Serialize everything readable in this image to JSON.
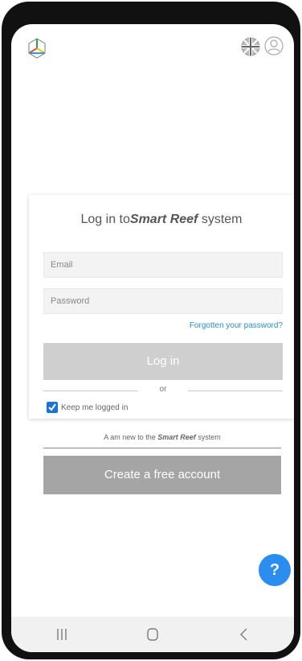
{
  "header": {
    "logo_icon": "cube-logo-icon",
    "language_icon": "uk-flag-icon",
    "account_icon": "user-icon"
  },
  "login": {
    "title_prefix": "Log in to",
    "title_brand": "Smart Reef",
    "title_suffix": " system",
    "email_placeholder": "Email",
    "password_placeholder": "Password",
    "forgot_label": "Forgotten your password?",
    "login_button": "Log in",
    "or_label": "or",
    "keep_logged_label": "Keep me logged in",
    "keep_logged_checked": true
  },
  "signup": {
    "prefix": "A am new to the ",
    "brand": "Smart Reef",
    "suffix": " system",
    "button_label": "Create a free account"
  },
  "help": {
    "label": "?"
  },
  "navbar": {
    "recent_icon": "recent-apps-icon",
    "home_icon": "home-icon",
    "back_icon": "back-icon"
  }
}
